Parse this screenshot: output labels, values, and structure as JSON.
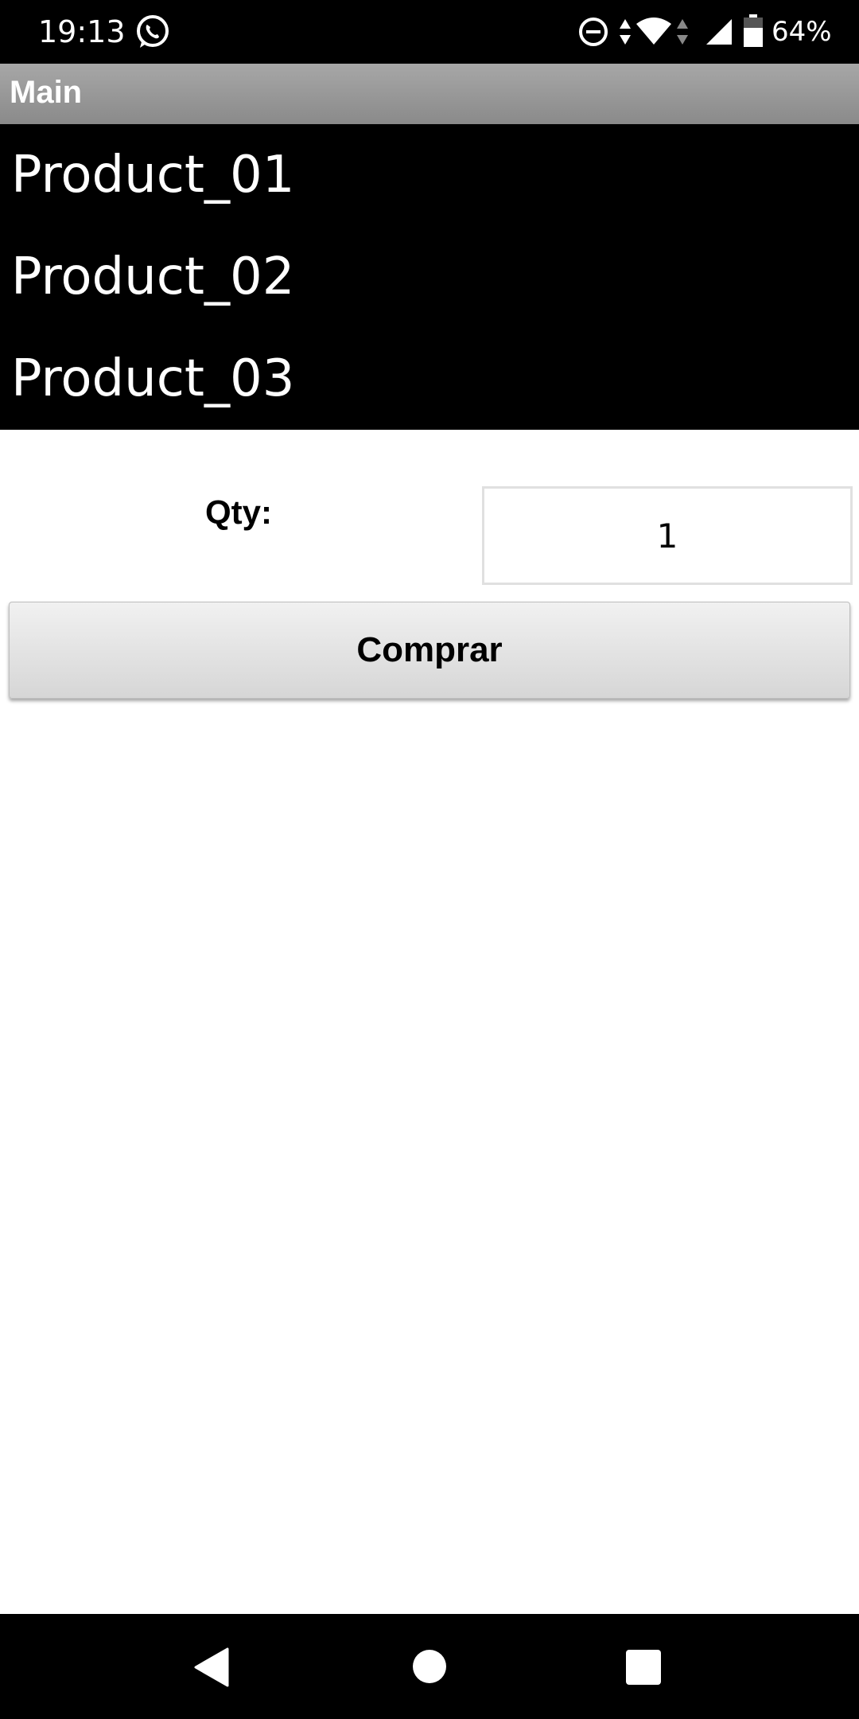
{
  "status_bar": {
    "time": "19:13",
    "battery_percent": "64%",
    "battery_level": 0.64,
    "icons": [
      "whatsapp-icon",
      "do-not-disturb-icon",
      "wifi-icon",
      "cell-signal-icon",
      "battery-icon"
    ]
  },
  "action_bar": {
    "title": "Main"
  },
  "products": [
    {
      "label": "Product_01"
    },
    {
      "label": "Product_02"
    },
    {
      "label": "Product_03"
    }
  ],
  "quantity": {
    "label": "Qty:",
    "value": "1"
  },
  "buy_button": {
    "label": "Comprar"
  },
  "nav_bar": {
    "icons": [
      "back-icon",
      "home-icon",
      "recents-icon"
    ]
  },
  "colors": {
    "list_background": "#000000",
    "action_bar": "#9a9a9a",
    "text_on_dark": "#ffffff"
  }
}
